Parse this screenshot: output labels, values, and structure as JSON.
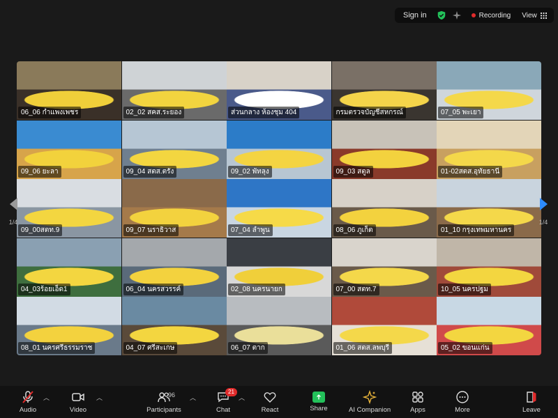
{
  "topbar": {
    "signin": "Sign in",
    "recording": "Recording",
    "view": "View"
  },
  "tiles": [
    {
      "name": "06_06 กำแพงเพชร"
    },
    {
      "name": "02_02 สคส.ระยอง"
    },
    {
      "name": "ส่วนกลาง ห้องชุม 404"
    },
    {
      "name": "กรมตรวจบัญชีสหกรณ์"
    },
    {
      "name": "07_05 พะเยา"
    },
    {
      "name": "09_06 ยะลา"
    },
    {
      "name": "09_04 สตส.ตรัง"
    },
    {
      "name": "09_02 พัทลุง"
    },
    {
      "name": "09_03 สตูล"
    },
    {
      "name": "01-02สตส.อุทัยธานี"
    },
    {
      "name": "09_00สตท.9"
    },
    {
      "name": "09_07 นราธิวาส"
    },
    {
      "name": "07_04 ลำพูน"
    },
    {
      "name": "08_06 ภูเก็ต"
    },
    {
      "name": "01_10 กรุงเทพมหานคร"
    },
    {
      "name": "04_03ร้อยเอ็ด1"
    },
    {
      "name": "06_04 นครสวรรค์"
    },
    {
      "name": "02_08 นครนายก"
    },
    {
      "name": "07_00 สตท.7"
    },
    {
      "name": "10_05 นครปฐม"
    },
    {
      "name": "08_01 นครศรีธรรมราช"
    },
    {
      "name": "04_07 ศรีสะเกษ"
    },
    {
      "name": "06_07 ตาก"
    },
    {
      "name": "01_06 สตส.ลพบุรี"
    },
    {
      "name": "05_02 ขอนแก่น"
    }
  ],
  "pagination": {
    "left": "1/4",
    "right": "1/4"
  },
  "toolbar": {
    "audio": "Audio",
    "video": "Video",
    "participants": "Participants",
    "participants_count": "96",
    "chat": "Chat",
    "chat_badge": "21",
    "react": "React",
    "share": "Share",
    "ai": "AI Companion",
    "apps": "Apps",
    "more": "More",
    "leave": "Leave"
  },
  "colors": {
    "active_speaker": "#23d959",
    "recording_dot": "#e02b2b",
    "share_green": "#23c15a",
    "leave_red": "#e02b2b",
    "nav_blue": "#2d8cff"
  }
}
